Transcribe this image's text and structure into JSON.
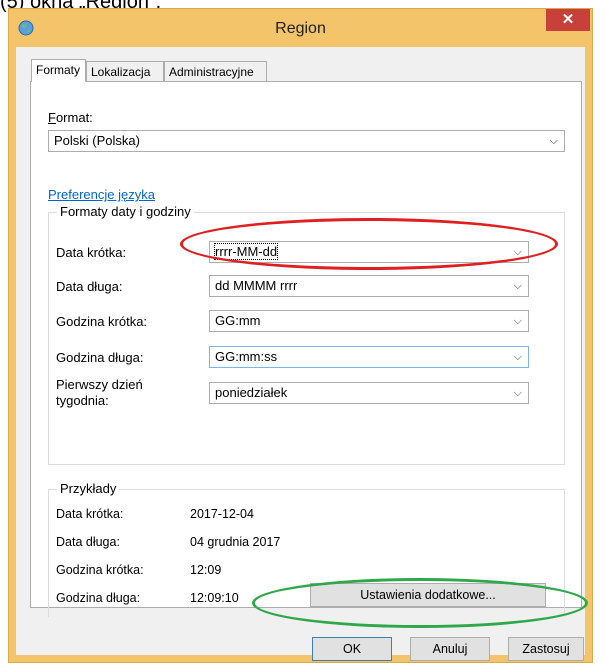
{
  "page_caption": "(5) okna „Region”.",
  "window": {
    "title": "Region",
    "close_glyph": "✕"
  },
  "tabs": [
    {
      "label": "Formaty",
      "active": true
    },
    {
      "label": "Lokalizacja",
      "active": false
    },
    {
      "label": "Administracyjne",
      "active": false
    }
  ],
  "format": {
    "label": "Format:",
    "value": "Polski (Polska)"
  },
  "language_link": "Preferencje języka",
  "date_time_group": {
    "legend": "Formaty daty i godziny",
    "rows": [
      {
        "label": "Data krótka:",
        "value": "rrrr-MM-dd"
      },
      {
        "label": "Data długa:",
        "value": "dd MMMM rrrr"
      },
      {
        "label": "Godzina krótka:",
        "value": "GG:mm"
      },
      {
        "label": "Godzina długa:",
        "value": "GG:mm:ss"
      },
      {
        "label": "Pierwszy dzień tygodnia:",
        "value": "poniedziałek"
      }
    ]
  },
  "examples": {
    "legend": "Przykłady",
    "rows": [
      {
        "label": "Data krótka:",
        "value": "2017-12-04"
      },
      {
        "label": "Data długa:",
        "value": "04 grudnia 2017"
      },
      {
        "label": "Godzina krótka:",
        "value": "12:09"
      },
      {
        "label": "Godzina długa:",
        "value": "12:09:10"
      }
    ]
  },
  "buttons": {
    "advanced": "Ustawienia dodatkowe...",
    "ok": "OK",
    "cancel": "Anuluj",
    "apply": "Zastosuj"
  },
  "icons": {
    "dropdown": "chevron-down-icon",
    "app": "globe-icon"
  },
  "colors": {
    "title_bar": "#f4c46b",
    "close": "#c7403a",
    "annotation_red": "#e02020",
    "annotation_green": "#2ea84a"
  }
}
